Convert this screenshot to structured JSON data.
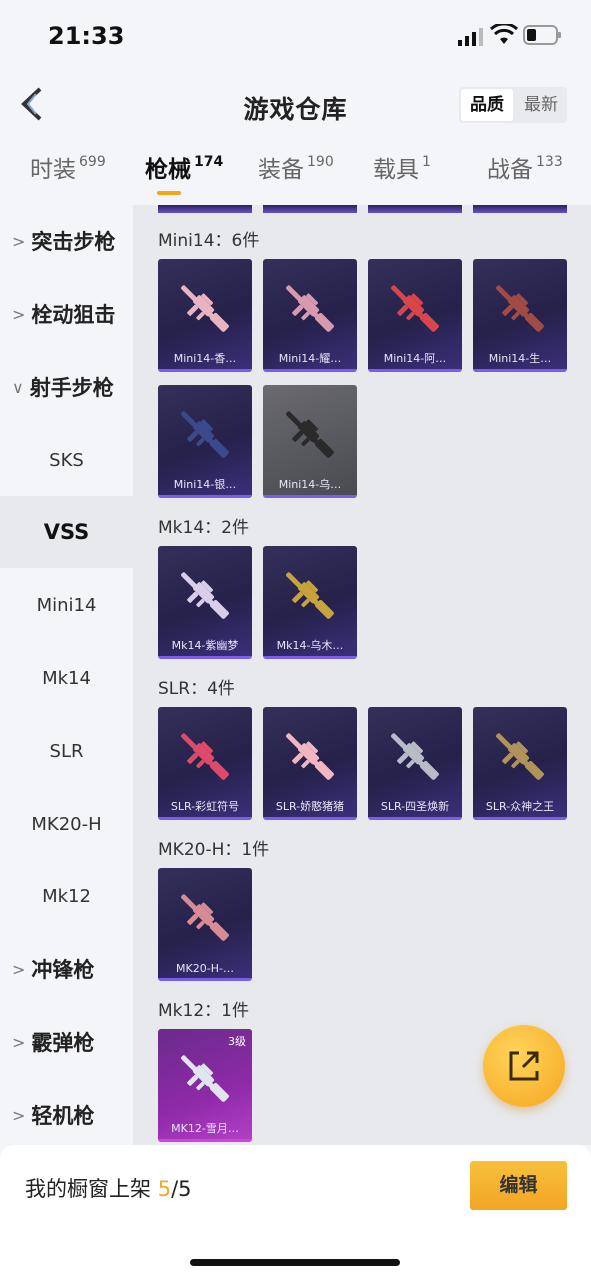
{
  "status": {
    "time": "21:33"
  },
  "header": {
    "title": "游戏仓库",
    "sort": [
      "品质",
      "最新"
    ]
  },
  "tabs": [
    {
      "label": "时装",
      "count": "699"
    },
    {
      "label": "枪械",
      "count": "174"
    },
    {
      "label": "装备",
      "count": "190"
    },
    {
      "label": "载具",
      "count": "1"
    },
    {
      "label": "战备",
      "count": "133"
    }
  ],
  "sidebar": {
    "assault": "突击步枪",
    "bolt": "栓动狙击",
    "marksman": "射手步枪",
    "sks": "SKS",
    "vss": "VSS",
    "mini14": "Mini14",
    "mk14": "Mk14",
    "slr": "SLR",
    "mk20h": "MK20-H",
    "mk12": "Mk12",
    "smg": "冲锋枪",
    "shotgun": "霰弹枪",
    "lmg": "轻机枪"
  },
  "sections": {
    "mini14": "Mini14：6件",
    "mk14": "Mk14：2件",
    "slr": "SLR：4件",
    "mk20h": "MK20-H：1件",
    "mk12": "Mk12：1件"
  },
  "cards": {
    "m1": "Mini14-香…",
    "m2": "Mini14-耀…",
    "m3": "Mini14-阿…",
    "m4": "Mini14-生…",
    "m5": "Mini14-银…",
    "m6": "Mini14-乌…",
    "k1": "Mk14-紫幽梦",
    "k2": "Mk14-乌木…",
    "s1": "SLR-彩虹符号",
    "s2": "SLR-娇憨猪猪",
    "s3": "SLR-四圣焕新",
    "s4": "SLR-众神之王",
    "h1": "MK20-H-…",
    "t1": "MK12-雪月…",
    "t1_level": "3级"
  },
  "bottom": {
    "label": "我的橱窗上架",
    "current": "5",
    "total": "/5",
    "edit": "编辑"
  },
  "icons": [
    "back-icon",
    "signal-icon",
    "wifi-icon",
    "battery-icon",
    "chevron-right-icon",
    "chevron-down-icon",
    "share-icon"
  ],
  "colors": {
    "accent": "#f4a61b",
    "card_border": "#7b5cf0",
    "legendary": "#b23fc7"
  }
}
